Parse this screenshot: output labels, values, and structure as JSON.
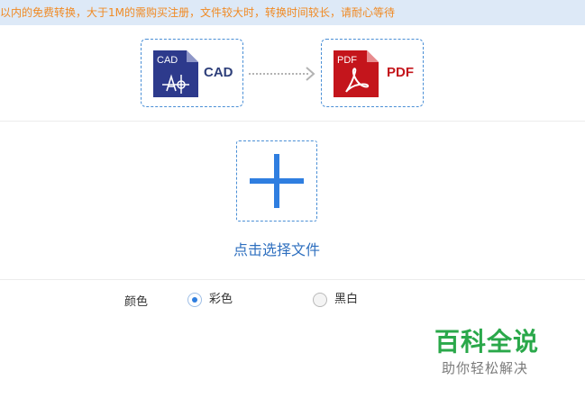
{
  "notice": {
    "text": "以内的免费转换，大于1M的需购买注册，文件较大时，转换时间较长，请耐心等待"
  },
  "conversion": {
    "source": {
      "icon_text": "CAD",
      "label": "CAD",
      "icon": "cad-file-icon"
    },
    "target": {
      "icon_text": "PDF",
      "label": "PDF",
      "icon": "pdf-file-icon"
    },
    "arrow_icon": "dotted-arrow-right-icon"
  },
  "upload": {
    "icon": "plus-icon",
    "label": "点击选择文件"
  },
  "color_setting": {
    "label": "颜色",
    "options": [
      {
        "label": "彩色",
        "selected": true
      },
      {
        "label": "黑白",
        "selected": false
      }
    ]
  },
  "watermark": {
    "title": "百科全说",
    "subtitle": "助你轻松解决"
  },
  "colors": {
    "notice_bg": "#dde9f7",
    "notice_text": "#f08a24",
    "accent_blue": "#2f7ee0",
    "cad_blue": "#2e3f7a",
    "pdf_red": "#c4151c",
    "watermark_green": "#2aa84a"
  }
}
